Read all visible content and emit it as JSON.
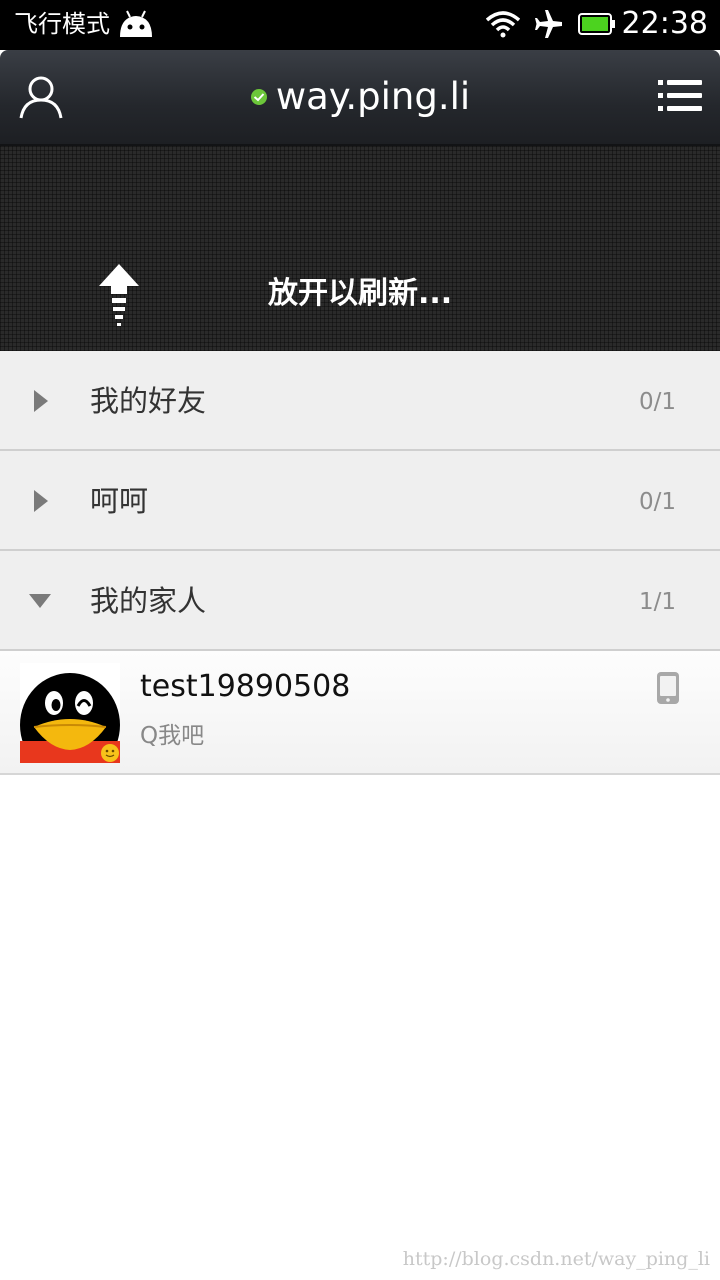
{
  "status_bar": {
    "mode_text": "飞行模式",
    "time": "22:38",
    "icons": [
      "android-icon",
      "wifi-icon",
      "airplane-icon",
      "battery-icon"
    ],
    "battery_color": "#4cd31f"
  },
  "title_bar": {
    "title": "way.ping.li",
    "online_color": "#6cc63a",
    "icons": [
      "profile-icon",
      "online-status-icon",
      "menu-icon"
    ]
  },
  "refresh": {
    "text": "放开以刷新..."
  },
  "groups": [
    {
      "name": "我的好友",
      "count": "0/1",
      "expanded": false
    },
    {
      "name": "呵呵",
      "count": "0/1",
      "expanded": false
    },
    {
      "name": "我的家人",
      "count": "1/1",
      "expanded": true
    }
  ],
  "friends": [
    {
      "name": "test19890508",
      "signature": "Q我吧",
      "device": "phone-icon"
    }
  ],
  "watermark": "http://blog.csdn.net/way_ping_li"
}
